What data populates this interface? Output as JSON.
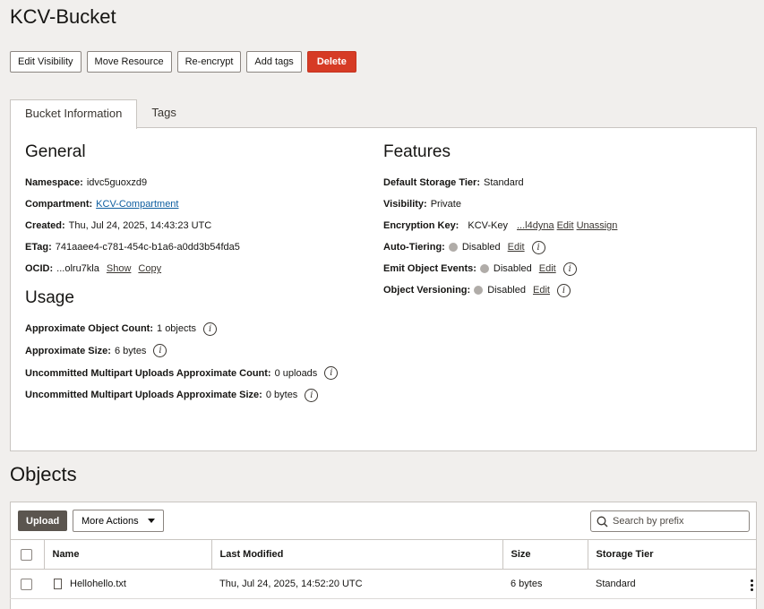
{
  "page": {
    "title": "KCV-Bucket"
  },
  "actions": {
    "edit_visibility": "Edit Visibility",
    "move_resource": "Move Resource",
    "re_encrypt": "Re-encrypt",
    "add_tags": "Add tags",
    "delete": "Delete"
  },
  "tabs": [
    {
      "label": "Bucket Information",
      "active": true
    },
    {
      "label": "Tags",
      "active": false
    }
  ],
  "general": {
    "title": "General",
    "namespace_label": "Namespace:",
    "namespace_value": "idvc5guoxzd9",
    "compartment_label": "Compartment:",
    "compartment_value": "KCV-Compartment",
    "created_label": "Created:",
    "created_value": "Thu, Jul 24, 2025, 14:43:23 UTC",
    "etag_label": "ETag:",
    "etag_value": "741aaee4-c781-454c-b1a6-a0dd3b54fda5",
    "ocid_label": "OCID:",
    "ocid_value": "...olru7kla",
    "show": "Show",
    "copy": "Copy"
  },
  "usage": {
    "title": "Usage",
    "object_count_label": "Approximate Object Count:",
    "object_count_value": "1 objects",
    "size_label": "Approximate Size:",
    "size_value": "6 bytes",
    "multipart_count_label": "Uncommitted Multipart Uploads Approximate Count:",
    "multipart_count_value": "0 uploads",
    "multipart_size_label": "Uncommitted Multipart Uploads Approximate Size:",
    "multipart_size_value": "0 bytes"
  },
  "features": {
    "title": "Features",
    "storage_tier_label": "Default Storage Tier:",
    "storage_tier_value": "Standard",
    "visibility_label": "Visibility:",
    "visibility_value": "Private",
    "encryption_label": "Encryption Key:",
    "encryption_value": "KCV-Key",
    "encryption_link": "...l4dyna",
    "encryption_edit": "Edit",
    "encryption_unassign": "Unassign",
    "auto_tiering_label": "Auto-Tiering:",
    "auto_tiering_value": "Disabled",
    "emit_events_label": "Emit Object Events:",
    "emit_events_value": "Disabled",
    "versioning_label": "Object Versioning:",
    "versioning_value": "Disabled",
    "edit": "Edit"
  },
  "objects": {
    "title": "Objects",
    "upload": "Upload",
    "more_actions": "More Actions",
    "search_placeholder": "Search by prefix",
    "columns": [
      "Name",
      "Last Modified",
      "Size",
      "Storage Tier"
    ],
    "rows": [
      {
        "name": "Hellohello.txt",
        "last_modified": "Thu, Jul 24, 2025, 14:52:20 UTC",
        "size": "6 bytes",
        "storage_tier": "Standard"
      }
    ]
  },
  "colors": {
    "delete_button": "#d63b25",
    "upload_button": "#5b554f",
    "link": "#0d5d9f",
    "background": "#f1efed"
  }
}
